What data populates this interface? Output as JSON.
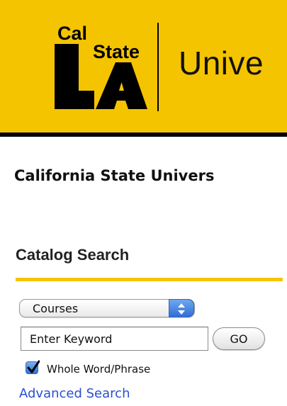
{
  "header": {
    "logo_line1": "Cal",
    "logo_line2": "State",
    "logo_line3": "LA",
    "title": "Unive",
    "background_color": "#f5c400"
  },
  "page": {
    "university_title": "California State Univers"
  },
  "catalog_search": {
    "heading": "Catalog Search",
    "select_value": "Courses",
    "keyword_placeholder": "Enter Keyword",
    "go_label": "GO",
    "whole_word_label": "Whole Word/Phrase",
    "whole_word_checked": true,
    "advanced_link": "Advanced Search"
  }
}
